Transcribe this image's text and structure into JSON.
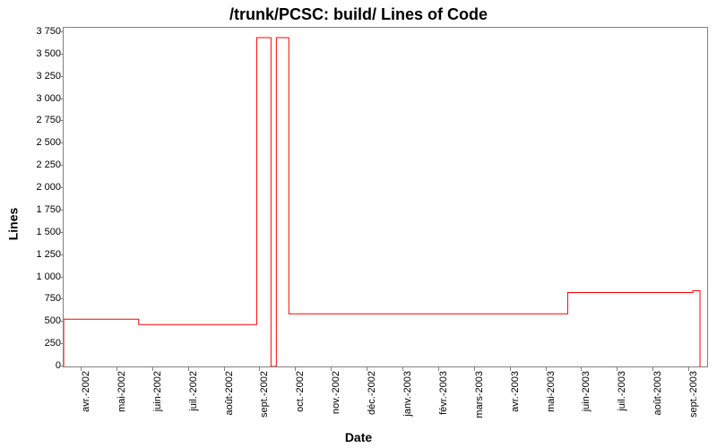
{
  "chart_data": {
    "type": "line",
    "title": "/trunk/PCSC: build/ Lines of Code",
    "xlabel": "Date",
    "ylabel": "Lines",
    "ylim": [
      0,
      3800
    ],
    "ytick_step": 250,
    "yticks": [
      0,
      250,
      500,
      750,
      1000,
      1250,
      1500,
      1750,
      2000,
      2250,
      2500,
      2750,
      3000,
      3250,
      3500,
      3750
    ],
    "categories": [
      "avr.-2002",
      "mai-2002",
      "juin-2002",
      "juil.-2002",
      "août-2002",
      "sept.-2002",
      "oct.-2002",
      "nov.-2002",
      "déc.-2002",
      "janv.-2003",
      "févr.-2003",
      "mars-2003",
      "avr.-2003",
      "mai-2003",
      "juin-2003",
      "juil.-2003",
      "août-2003",
      "sept.-2003"
    ],
    "series": [
      {
        "name": "Lines of Code",
        "color": "#ff0000",
        "points": [
          {
            "x": 0.0,
            "y": 0
          },
          {
            "x": 0.0,
            "y": 530
          },
          {
            "x": 2.1,
            "y": 530
          },
          {
            "x": 2.1,
            "y": 470
          },
          {
            "x": 5.4,
            "y": 470
          },
          {
            "x": 5.4,
            "y": 3690
          },
          {
            "x": 5.8,
            "y": 3690
          },
          {
            "x": 5.8,
            "y": 0
          },
          {
            "x": 5.95,
            "y": 0
          },
          {
            "x": 5.95,
            "y": 3690
          },
          {
            "x": 6.3,
            "y": 3690
          },
          {
            "x": 6.3,
            "y": 590
          },
          {
            "x": 14.1,
            "y": 590
          },
          {
            "x": 14.1,
            "y": 830
          },
          {
            "x": 17.6,
            "y": 830
          },
          {
            "x": 17.6,
            "y": 850
          },
          {
            "x": 17.8,
            "y": 850
          },
          {
            "x": 17.8,
            "y": 0
          }
        ]
      }
    ]
  }
}
